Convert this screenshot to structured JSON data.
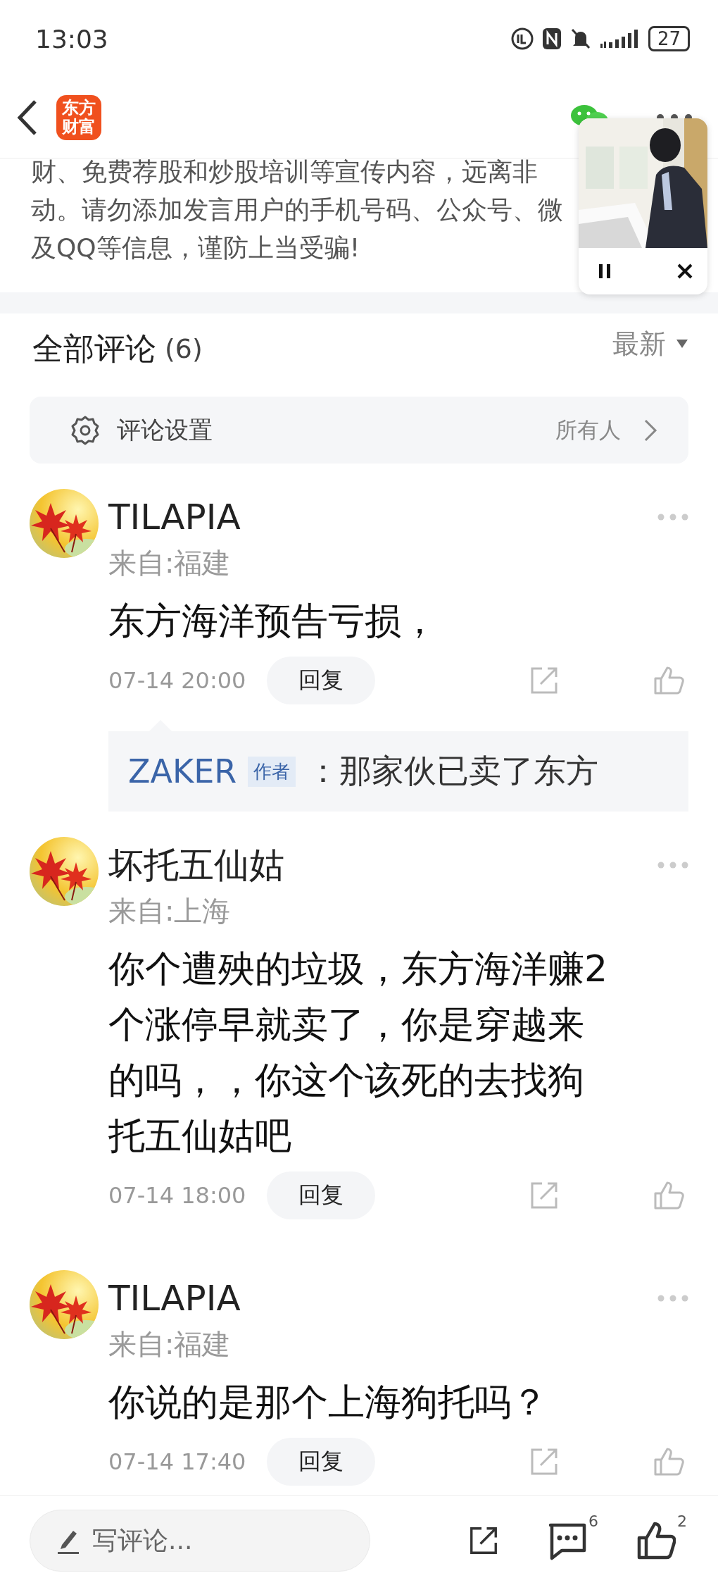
{
  "status_bar": {
    "time": "13:03",
    "battery": "27"
  },
  "header": {
    "logo_lines": [
      "东方",
      "财富"
    ]
  },
  "notice": {
    "lines": [
      "财、免费荐股和炒股培训等宣传内容，远离非",
      "动。请勿添加发言用户的手机号码、公众号、微",
      "及QQ等信息，谨防上当受骗!"
    ]
  },
  "comments_header": {
    "title": "全部评论",
    "count": "(6)",
    "sort": "最新"
  },
  "settings_row": {
    "label": "评论设置",
    "value": "所有人"
  },
  "comments": [
    {
      "user": "TILAPIA",
      "location": "来自:福建",
      "text": "东方海洋预告亏损，",
      "time": "07-14 20:00",
      "reply_button": "回复",
      "replies": [
        {
          "user": "ZAKER",
          "badge": "作者",
          "text": "：那家伙已卖了东方"
        }
      ]
    },
    {
      "user": "坏托五仙姑",
      "location": "来自:上海",
      "text": "你个遭殃的垃圾，东方海洋赚2个涨停早就卖了，你是穿越来的吗，，你这个该死的去找狗托五仙姑吧",
      "time": "07-14 18:00",
      "reply_button": "回复"
    },
    {
      "user": "TILAPIA",
      "location": "来自:福建",
      "text": "你说的是那个上海狗托吗？",
      "time": "07-14 17:40",
      "reply_button": "回复"
    }
  ],
  "bottom_bar": {
    "placeholder": "写评论...",
    "comment_count": "6",
    "like_count": "2"
  }
}
